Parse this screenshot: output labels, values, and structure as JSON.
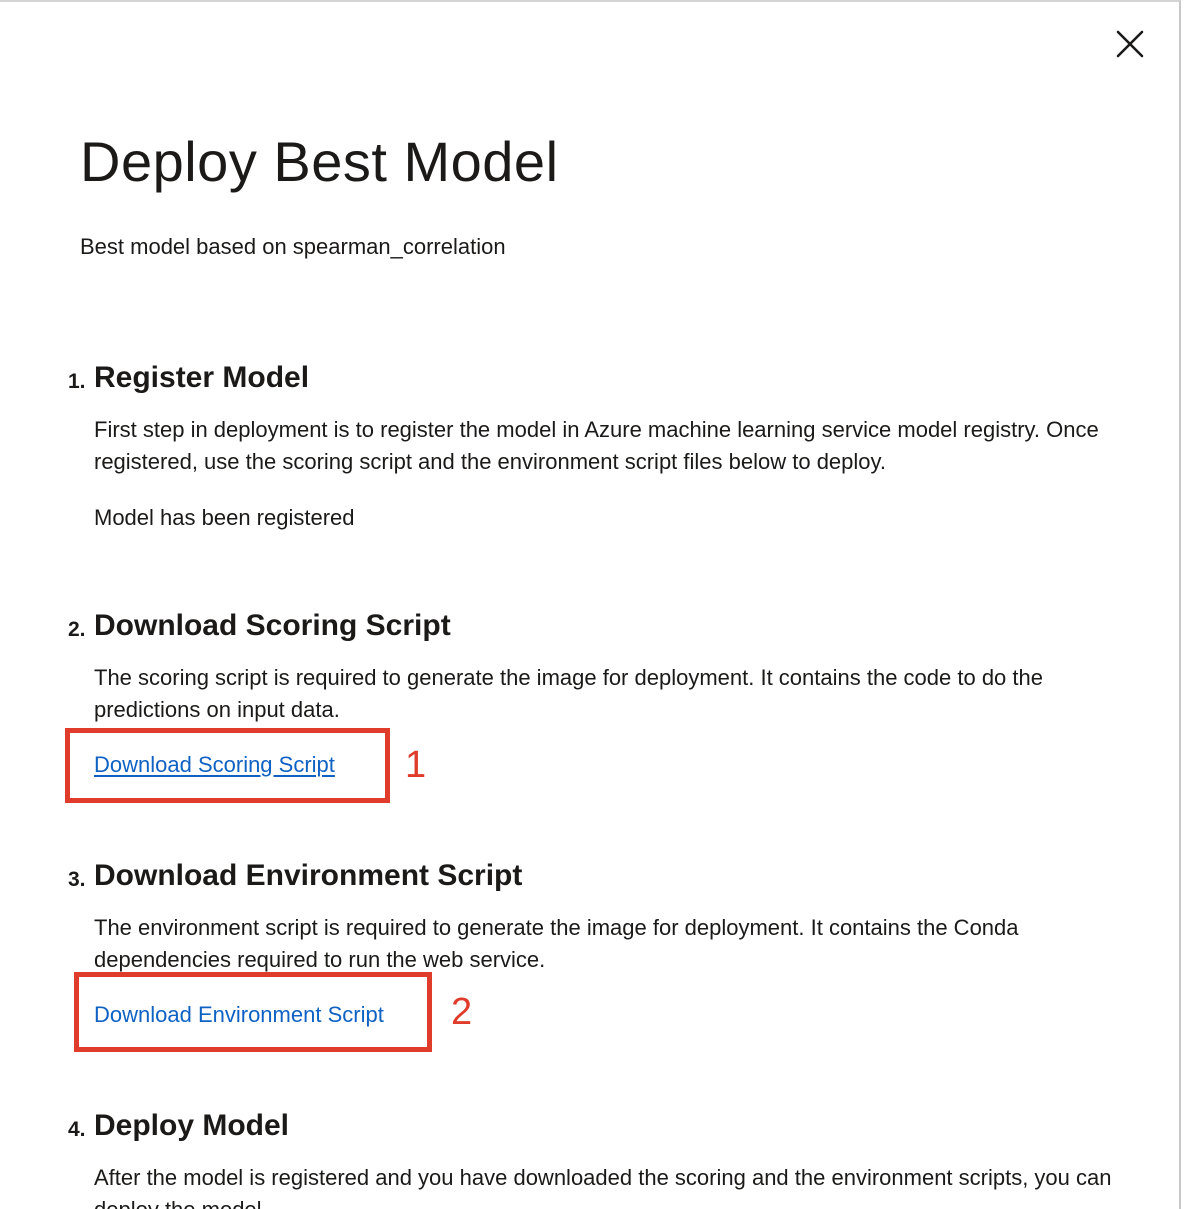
{
  "dialog": {
    "title": "Deploy Best Model",
    "subtitle": "Best model based on spearman_correlation",
    "close_icon": "close-icon"
  },
  "steps": [
    {
      "number": "1.",
      "title": "Register Model",
      "body": "First step in deployment is to register the model in Azure machine learning service model registry. Once registered, use the scoring script and the environment script files below to deploy.",
      "status": "Model has been registered"
    },
    {
      "number": "2.",
      "title": "Download Scoring Script",
      "body": "The scoring script is required to generate the image for deployment. It contains the code to do the predictions on input data.",
      "link": "Download Scoring Script"
    },
    {
      "number": "3.",
      "title": "Download Environment Script",
      "body": "The environment script is required to generate the image for deployment. It contains the Conda dependencies required to run the web service.",
      "link": "Download Environment Script"
    },
    {
      "number": "4.",
      "title": "Deploy Model",
      "body": "After the model is registered and you have downloaded the scoring and the environment scripts, you can deploy the model."
    }
  ],
  "annotations": [
    {
      "label": "1",
      "color": "#e03c2b"
    },
    {
      "label": "2",
      "color": "#e03c2b"
    }
  ],
  "colors": {
    "link": "#0f62c4",
    "annotation": "#e03c2b",
    "text": "#1b1a19"
  }
}
